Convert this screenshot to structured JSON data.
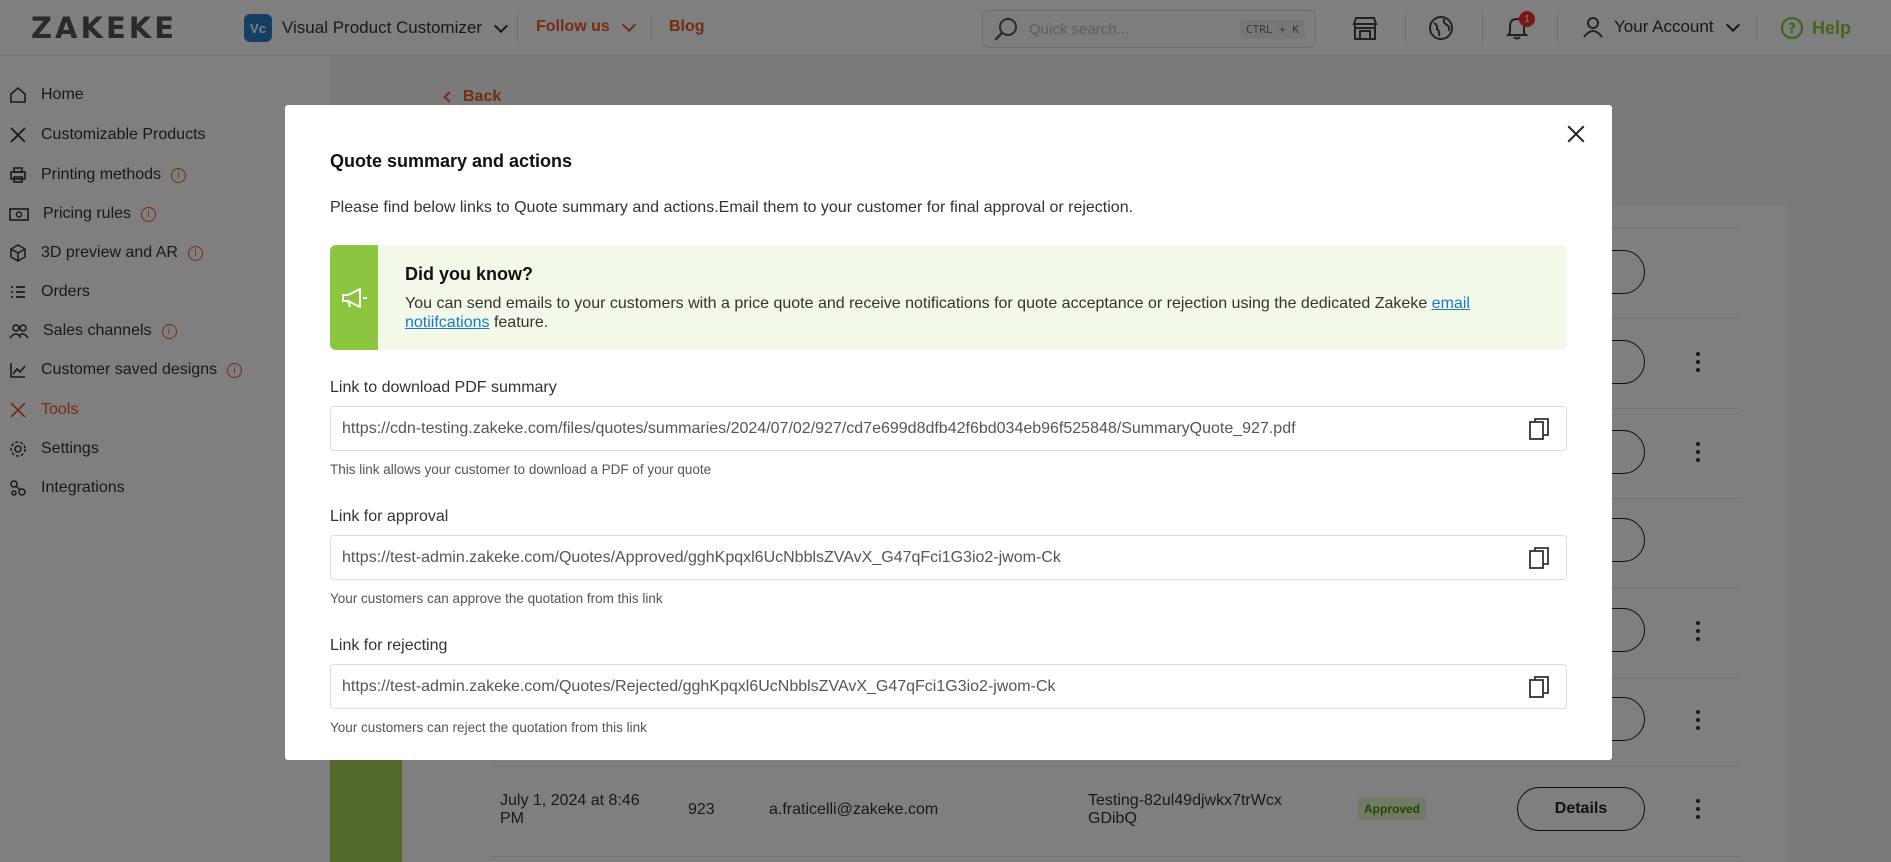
{
  "header": {
    "logo": "ZAKEKE",
    "product": {
      "badge": "Vc",
      "name": "Visual Product Customizer"
    },
    "follow_us": "Follow us",
    "blog": "Blog",
    "search": {
      "placeholder": "Quick search...",
      "shortcut": "CTRL + K"
    },
    "notifications_count": "1",
    "account": "Your Account",
    "help": "Help"
  },
  "sidebar": {
    "items": [
      {
        "label": "Home",
        "icon": "home-icon"
      },
      {
        "label": "Customizable Products",
        "icon": "tools-icon"
      },
      {
        "label": "Printing methods",
        "icon": "printer-icon",
        "info": true
      },
      {
        "label": "Pricing rules",
        "icon": "money-icon",
        "info": true
      },
      {
        "label": "3D preview and AR",
        "icon": "cube-icon",
        "info": true
      },
      {
        "label": "Orders",
        "icon": "list-icon"
      },
      {
        "label": "Sales channels",
        "icon": "people-icon",
        "info": true
      },
      {
        "label": "Customer saved designs",
        "icon": "chart-icon",
        "info": true
      },
      {
        "label": "Tools",
        "icon": "wrench-icon",
        "active": true
      },
      {
        "label": "Settings",
        "icon": "gear-icon"
      },
      {
        "label": "Integrations",
        "icon": "nodes-icon"
      }
    ]
  },
  "main": {
    "back": "Back",
    "row_button": "Details",
    "last_row": {
      "date": "July 1, 2024 at 8:46 PM",
      "number": "923",
      "email": "a.fraticelli@zakeke.com",
      "reference": "Testing-82ul49djwkx7trWcxGDibQ",
      "status": "Approved"
    }
  },
  "modal": {
    "title": "Quote summary and actions",
    "intro": "Please find below links to Quote summary and actions.Email them to your customer for final approval or rejection.",
    "tip": {
      "heading": "Did you know?",
      "text": "You can send emails to your customers with a price quote and receive notifications for quote acceptance or rejection using the dedicated Zakeke",
      "link": "email notiifcations",
      "tail": "feature."
    },
    "fields": [
      {
        "label": "Link to download PDF summary",
        "value": "https://cdn-testing.zakeke.com/files/quotes/summaries/2024/07/02/927/cd7e699d8dfb42f6bd034eb96f525848/SummaryQuote_927.pdf",
        "help": "This link allows your customer to download a PDF of your quote"
      },
      {
        "label": "Link for approval",
        "value": "https://test-admin.zakeke.com/Quotes/Approved/gghKpqxl6UcNbblsZVAvX_G47qFci1G3io2-jwom-Ck",
        "help": "Your customers can approve the quotation from this link"
      },
      {
        "label": "Link for rejecting",
        "value": "https://test-admin.zakeke.com/Quotes/Rejected/gghKpqxl6UcNbblsZVAvX_G47qFci1G3io2-jwom-Ck",
        "help": "Your customers can reject the quotation from this link"
      }
    ]
  },
  "colors": {
    "brand_orange": "#e85a2a",
    "brand_green": "#8cc63f",
    "link_blue": "#1a79c8",
    "overlay": "rgba(0,0,0,0.5)"
  }
}
